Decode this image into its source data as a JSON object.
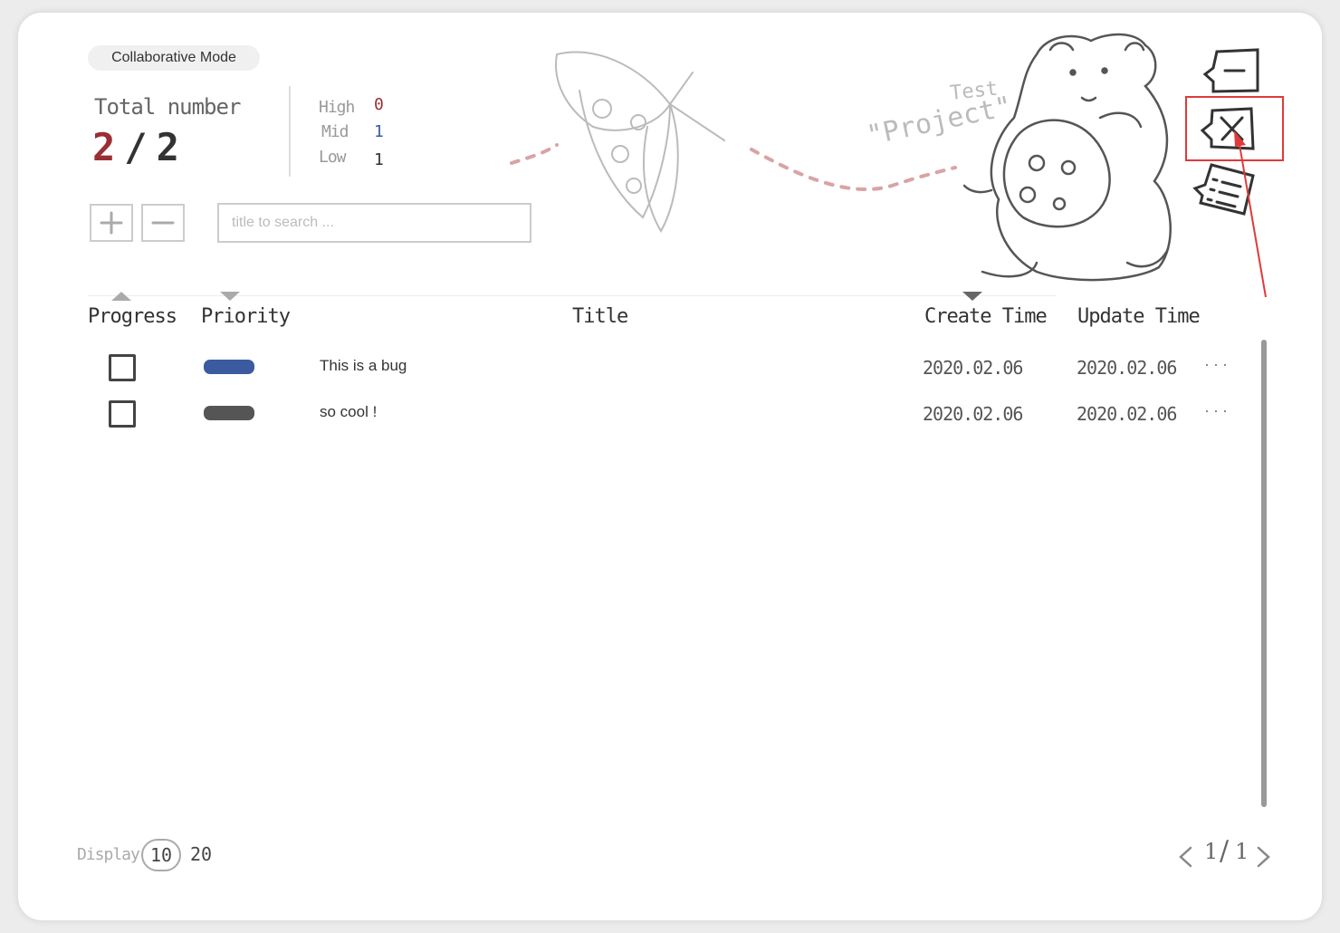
{
  "header": {
    "mode_label": "Collaborative Mode",
    "total_label": "Total number",
    "total_done": "2",
    "total_slash": "/",
    "total_all": "2",
    "priority_counts": [
      {
        "label": "High",
        "value": "0",
        "color": "#9b2e34"
      },
      {
        "label": "Mid",
        "value": "1",
        "color": "#3b5aa0"
      },
      {
        "label": "Low",
        "value": "1",
        "color": "#333333"
      }
    ],
    "illustration_text": {
      "line1": "Test",
      "line2": "\"Project\""
    }
  },
  "toolbar": {
    "add_icon": "plus-icon",
    "remove_icon": "minus-icon",
    "search_placeholder": "title to search ..."
  },
  "side_actions": [
    {
      "name": "collapse",
      "icon": "minus-bubble-icon"
    },
    {
      "name": "close",
      "icon": "close-bubble-icon",
      "highlighted": true
    },
    {
      "name": "list",
      "icon": "list-bubble-icon"
    }
  ],
  "table": {
    "columns": [
      "Progress",
      "Priority",
      "Title",
      "Create Time",
      "Update Time"
    ],
    "rows": [
      {
        "done": false,
        "priority_color": "#3b5aa0",
        "title": "This is a bug",
        "create_time": "2020.02.06",
        "update_time": "2020.02.06",
        "more": "···"
      },
      {
        "done": false,
        "priority_color": "#555555",
        "title": "so cool !",
        "create_time": "2020.02.06",
        "update_time": "2020.02.06",
        "more": "···"
      }
    ]
  },
  "footer": {
    "display_label": "Display",
    "page_size_options": [
      "10",
      "20"
    ],
    "selected_page_size": "10",
    "page_current": "1",
    "page_total": "1",
    "page_sep": "/"
  },
  "colors": {
    "accent_red": "#9b2e34",
    "accent_blue": "#3b5aa0",
    "highlight": "#e03a3a"
  }
}
